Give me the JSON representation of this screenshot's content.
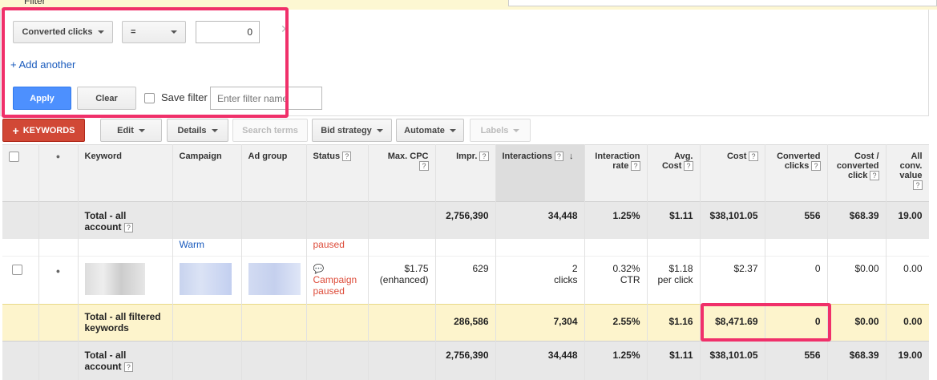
{
  "top_title": "Filter",
  "filter": {
    "field_value": "Converted clicks",
    "operator_value": "=",
    "amount_value": "0",
    "remove_glyph": "✕",
    "add_another": "+ Add another",
    "apply_label": "Apply",
    "clear_label": "Clear",
    "save_filter_label": "Save filter",
    "filter_name_placeholder": "Enter filter name"
  },
  "toolbar": {
    "keywords_label": "KEYWORDS",
    "keywords_plus": "+",
    "edit_label": "Edit",
    "details_label": "Details",
    "search_terms_label": "Search terms",
    "bid_strategy_label": "Bid strategy",
    "automate_label": "Automate",
    "labels_label": "Labels"
  },
  "table": {
    "headers": {
      "dot": "●",
      "keyword": "Keyword",
      "campaign": "Campaign",
      "ad_group": "Ad group",
      "status": "Status",
      "max_cpc": "Max. CPC",
      "impr": "Impr.",
      "interactions": "Interactions",
      "interaction_rate": "Interaction rate",
      "avg_cost": "Avg. Cost",
      "cost": "Cost",
      "converted_clicks": "Converted clicks",
      "cost_per_converted": "Cost / converted click",
      "all_conv_value": "All conv. value"
    },
    "help_glyph": "?",
    "sort_arrow": "↓",
    "total_account": {
      "label": "Total - all account",
      "impr": "2,756,390",
      "interactions": "34,448",
      "rate": "1.25%",
      "avg_cost": "$1.11",
      "cost": "$38,101.05",
      "converted": "556",
      "cost_per_conv": "$68.39",
      "conv_value": "19.00"
    },
    "partial_row": {
      "campaign": "Warm",
      "status": "paused"
    },
    "row": {
      "dot": "●",
      "status_icon": "💬",
      "status": "Campaign paused",
      "max_cpc": "$1.75",
      "max_cpc_note": "(enhanced)",
      "impr": "629",
      "interactions_num": "2",
      "interactions_unit": "clicks",
      "rate": "0.32%",
      "rate_unit": "CTR",
      "avg_cost": "$1.18",
      "avg_cost_unit": "per click",
      "cost": "$2.37",
      "converted": "0",
      "cost_per_conv": "$0.00",
      "conv_value": "0.00"
    },
    "total_filtered": {
      "label": "Total - all filtered keywords",
      "impr": "286,586",
      "interactions": "7,304",
      "rate": "2.55%",
      "avg_cost": "$1.16",
      "cost": "$8,471.69",
      "converted": "0",
      "cost_per_conv": "$0.00",
      "conv_value": "0.00"
    },
    "total_account_2": {
      "label": "Total - all account",
      "impr": "2,756,390",
      "interactions": "34,448",
      "rate": "1.25%",
      "avg_cost": "$1.11",
      "cost": "$38,101.05",
      "converted": "556",
      "cost_per_conv": "$68.39",
      "conv_value": "19.00"
    }
  },
  "colors": {
    "accent_red": "#dd4b39",
    "highlight": "#f0306a",
    "apply_blue": "#4d90fe",
    "link_blue": "#1a5bbd",
    "filtered_row_bg": "#fdf4cc"
  }
}
